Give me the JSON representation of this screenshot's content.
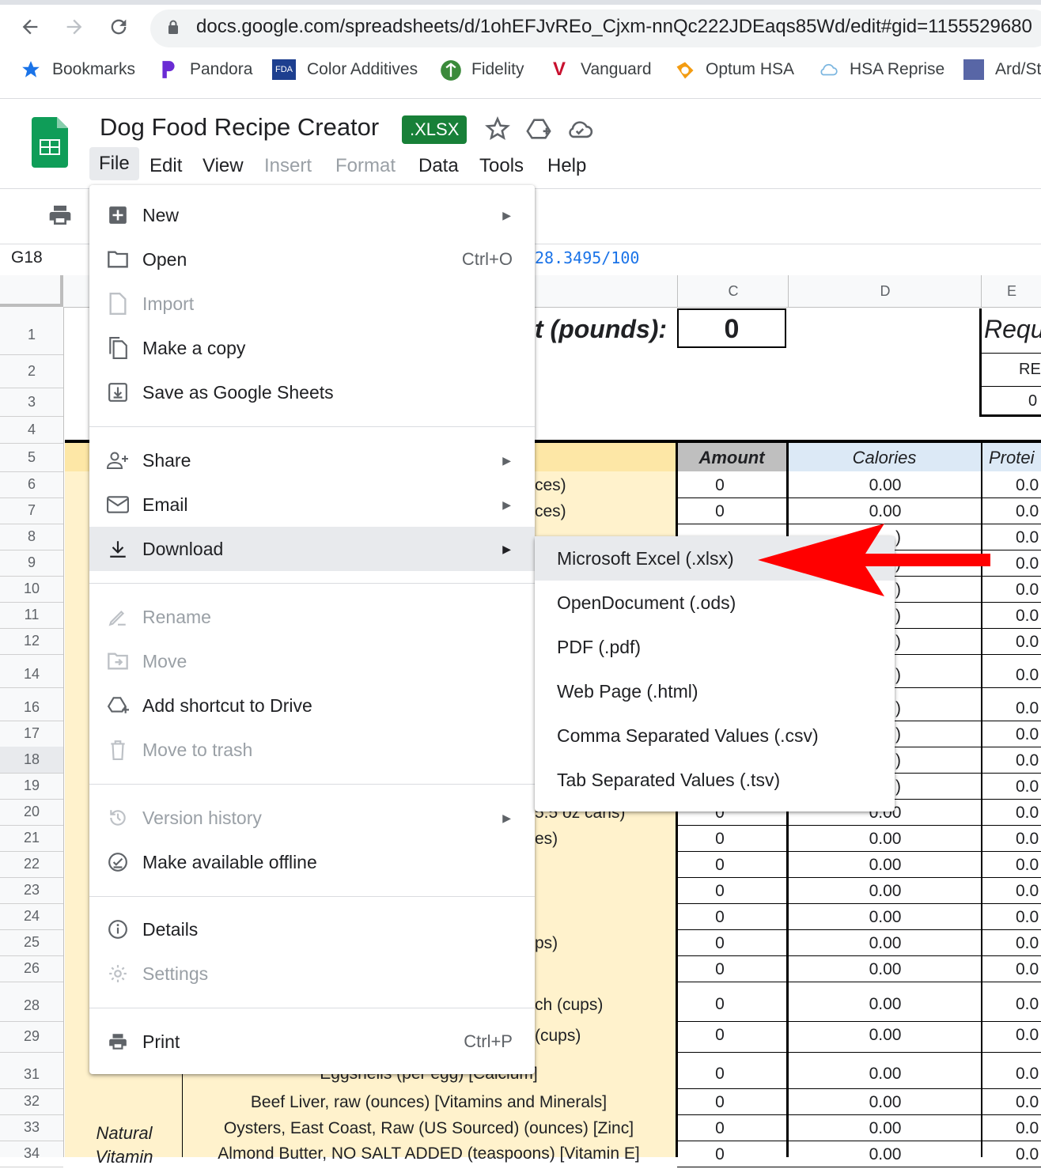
{
  "browser": {
    "url": "docs.google.com/spreadsheets/d/1ohEFJvREo_Cjxm-nnQc222JDEaqs85Wd/edit#gid=1155529680",
    "bookmarks": [
      "Bookmarks",
      "Pandora",
      "Color Additives",
      "Fidelity",
      "Vanguard",
      "Optum HSA",
      "HSA Reprise",
      "Ard/St"
    ]
  },
  "doc": {
    "title": "Dog Food Recipe Creator",
    "badge": ".XLSX"
  },
  "menubar": [
    "File",
    "Edit",
    "View",
    "Insert",
    "Format",
    "Data",
    "Tools",
    "Help"
  ],
  "formula_bar": {
    "cell_ref": "G18",
    "formula": "28.3495/100"
  },
  "grid": {
    "columns": [
      "C",
      "D",
      "E"
    ],
    "rows": [
      "1",
      "2",
      "3",
      "4",
      "5",
      "6",
      "7",
      "8",
      "9",
      "10",
      "11",
      "12",
      "14",
      "16",
      "17",
      "18",
      "19",
      "20",
      "21",
      "22",
      "23",
      "24",
      "25",
      "26",
      "28",
      "29",
      "31",
      "32",
      "33",
      "34"
    ],
    "header_weight_label": "t (pounds):",
    "weight_value": "0",
    "requ_label": "Requ",
    "re_label": "RE",
    "re_value": "0",
    "amount_header": "Amount",
    "calories_header": "Calories",
    "protein_header": "Protei",
    "partial_labels": {
      "r6": "ces)",
      "r7": "ces)",
      "r20": "5.5 oz cans)",
      "r21": "es)",
      "r25": "ps)",
      "r28": "ch (cups)",
      "r29": " (cups)"
    },
    "full_labels": {
      "r31": "Eggshells (per egg) [Calcium]",
      "r32": "Beef Liver, raw (ounces) [Vitamins and Minerals]",
      "r33": "Oysters, East Coast, Raw (US Sourced) (ounces) [Zinc]",
      "r34": "Almond Butter, NO SALT ADDED (teaspoons) [Vitamin E]"
    },
    "section_label": "Natural Vitamin",
    "amount_value": "0",
    "calorie_value": "0.00",
    "protein_value": "0.0",
    "partial_calorie": ")"
  },
  "file_menu": {
    "new": "New",
    "open": "Open",
    "open_shortcut": "Ctrl+O",
    "import": "Import",
    "make_copy": "Make a copy",
    "save_as_sheets": "Save as Google Sheets",
    "share": "Share",
    "email": "Email",
    "download": "Download",
    "rename": "Rename",
    "move": "Move",
    "add_shortcut": "Add shortcut to Drive",
    "move_to_trash": "Move to trash",
    "version_history": "Version history",
    "make_offline": "Make available offline",
    "details": "Details",
    "settings": "Settings",
    "print": "Print",
    "print_shortcut": "Ctrl+P"
  },
  "download_menu": [
    "Microsoft Excel (.xlsx)",
    "OpenDocument (.ods)",
    "PDF (.pdf)",
    "Web Page (.html)",
    "Comma Separated Values (.csv)",
    "Tab Separated Values (.tsv)"
  ],
  "colors": {
    "sheets_green": "#0f9d58",
    "badge_green": "#188038",
    "arrow_red": "#ff0000",
    "cell_yellow": "#fff2cc",
    "calories_blue": "#dce9f6",
    "amount_gray": "#bfbfbf"
  }
}
